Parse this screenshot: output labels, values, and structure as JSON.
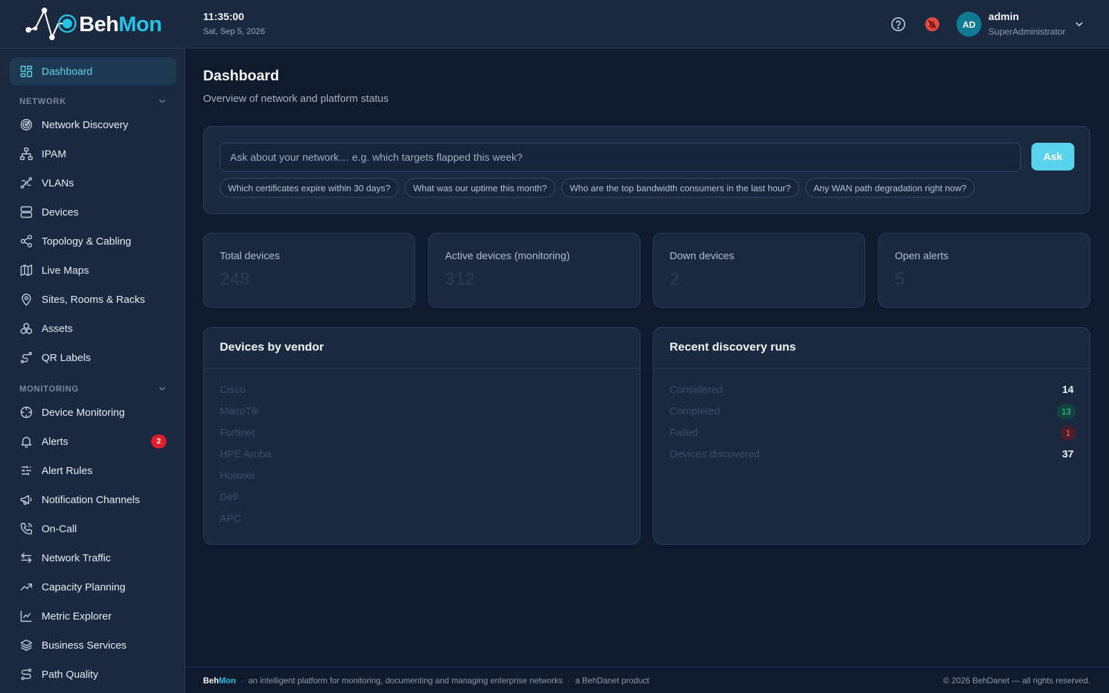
{
  "brand": {
    "part1": "Beh",
    "part2": "Mon"
  },
  "clock": {
    "time": "11:35:00",
    "date": "Sat, Sep 5, 2026"
  },
  "user": {
    "initials": "AD",
    "name": "admin",
    "role": "SuperAdministrator"
  },
  "icons": {
    "help": "help-circle-icon",
    "notifications": "bell-off-icon",
    "user_menu": "chevron-down-icon"
  },
  "sidebar": {
    "dashboard": "Dashboard",
    "network_section": "NETWORK",
    "monitoring_section": "MONITORING",
    "network": [
      {
        "label": "Network Discovery",
        "icon": "radar-icon"
      },
      {
        "label": "IPAM",
        "icon": "hierarchy-icon"
      },
      {
        "label": "VLANs",
        "icon": "network-nodes-icon"
      },
      {
        "label": "Devices",
        "icon": "server-icon"
      },
      {
        "label": "Topology & Cabling",
        "icon": "share-icon"
      },
      {
        "label": "Live Maps",
        "icon": "map-icon"
      },
      {
        "label": "Sites, Rooms & Racks",
        "icon": "location-pin-icon"
      },
      {
        "label": "Assets",
        "icon": "boxes-icon"
      },
      {
        "label": "QR Labels",
        "icon": "route-icon"
      }
    ],
    "monitoring": [
      {
        "label": "Device Monitoring",
        "icon": "crosshair-icon"
      },
      {
        "label": "Alerts",
        "icon": "bell-icon",
        "badge": "2"
      },
      {
        "label": "Alert Rules",
        "icon": "sliders-icon"
      },
      {
        "label": "Notification Channels",
        "icon": "megaphone-icon"
      },
      {
        "label": "On-Call",
        "icon": "phone-icon"
      },
      {
        "label": "Network Traffic",
        "icon": "arrows-left-right-icon"
      },
      {
        "label": "Capacity Planning",
        "icon": "trending-up-icon"
      },
      {
        "label": "Metric Explorer",
        "icon": "line-chart-icon"
      },
      {
        "label": "Business Services",
        "icon": "layers-icon"
      },
      {
        "label": "Path Quality",
        "icon": "path-icon"
      }
    ]
  },
  "page": {
    "title": "Dashboard",
    "subtitle": "Overview of network and platform status"
  },
  "ask": {
    "placeholder": "Ask about your network… e.g. which targets flapped this week?",
    "value": "",
    "button": "Ask",
    "suggestions": [
      "Which certificates expire within 30 days?",
      "What was our uptime this month?",
      "Who are the top bandwidth consumers in the last hour?",
      "Any WAN path degradation right now?"
    ]
  },
  "stats": [
    {
      "label": "Total devices",
      "value": "248"
    },
    {
      "label": "Active devices (monitoring)",
      "value": "312"
    },
    {
      "label": "Down devices",
      "value": "2"
    },
    {
      "label": "Open alerts",
      "value": "5"
    }
  ],
  "vendors": {
    "title": "Devices by vendor",
    "items": [
      "Cisco",
      "MikroTik",
      "Fortinet",
      "HPE Aruba",
      "Huawei",
      "Dell",
      "APC"
    ]
  },
  "discovery": {
    "title": "Recent discovery runs",
    "rows": [
      {
        "label": "Considered",
        "value": "14",
        "style": "plain"
      },
      {
        "label": "Completed",
        "value": "13",
        "style": "green"
      },
      {
        "label": "Failed",
        "value": "1",
        "style": "red"
      },
      {
        "label": "Devices discovered",
        "value": "37",
        "style": "plain"
      }
    ]
  },
  "footer": {
    "tagline": "an intelligent platform for monitoring, documenting and managing enterprise networks",
    "product": "a BehDanet product",
    "copyright": "© 2026 BehDanet — all rights reserved."
  },
  "colors": {
    "accent": "#22c3e6",
    "active_text": "#5dd3ec",
    "badge": "#e21d2e",
    "success": "#35d39b",
    "danger": "#ff6b7c"
  }
}
